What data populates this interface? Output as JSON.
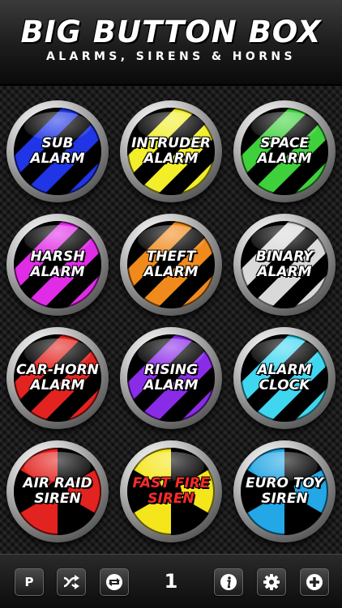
{
  "header": {
    "title": "BIG BUTTON BOX",
    "subtitle": "ALARMS, SIRENS & HORNS"
  },
  "buttons": [
    {
      "line1": "SUB",
      "line2": "ALARM",
      "pattern": "stripes",
      "color": "#1f35e6"
    },
    {
      "line1": "INTRUDER",
      "line2": "ALARM",
      "pattern": "stripes",
      "color": "#f2ee2a"
    },
    {
      "line1": "SPACE",
      "line2": "ALARM",
      "pattern": "stripes",
      "color": "#3ed13b"
    },
    {
      "line1": "HARSH",
      "line2": "ALARM",
      "pattern": "stripes",
      "color": "#e02ce6"
    },
    {
      "line1": "THEFT",
      "line2": "ALARM",
      "pattern": "stripes",
      "color": "#f08a1c"
    },
    {
      "line1": "BINARY",
      "line2": "ALARM",
      "pattern": "stripes",
      "color": "#d9d9d9"
    },
    {
      "line1": "CAR-HORN",
      "line2": "ALARM",
      "pattern": "stripes",
      "color": "#e3231f"
    },
    {
      "line1": "RISING",
      "line2": "ALARM",
      "pattern": "stripes",
      "color": "#8a2be8"
    },
    {
      "line1": "ALARM",
      "line2": "CLOCK",
      "pattern": "stripes",
      "color": "#3fd7f0"
    },
    {
      "line1": "AIR RAID",
      "line2": "SIREN",
      "pattern": "sectors",
      "color": "#e3231f",
      "label_color": "#ffffff"
    },
    {
      "line1": "FAST FIRE",
      "line2": "SIREN",
      "pattern": "sectors",
      "color": "#f5e61c",
      "label_color": "#ff2a2a"
    },
    {
      "line1": "EURO TOY",
      "line2": "SIREN",
      "pattern": "sectors",
      "color": "#23a7e6",
      "label_color": "#ffffff"
    }
  ],
  "toolbar": {
    "p_label": "P",
    "counter": "1",
    "icons": [
      "shuffle-icon",
      "repeat-icon",
      "info-icon",
      "gear-icon",
      "plus-icon"
    ]
  }
}
